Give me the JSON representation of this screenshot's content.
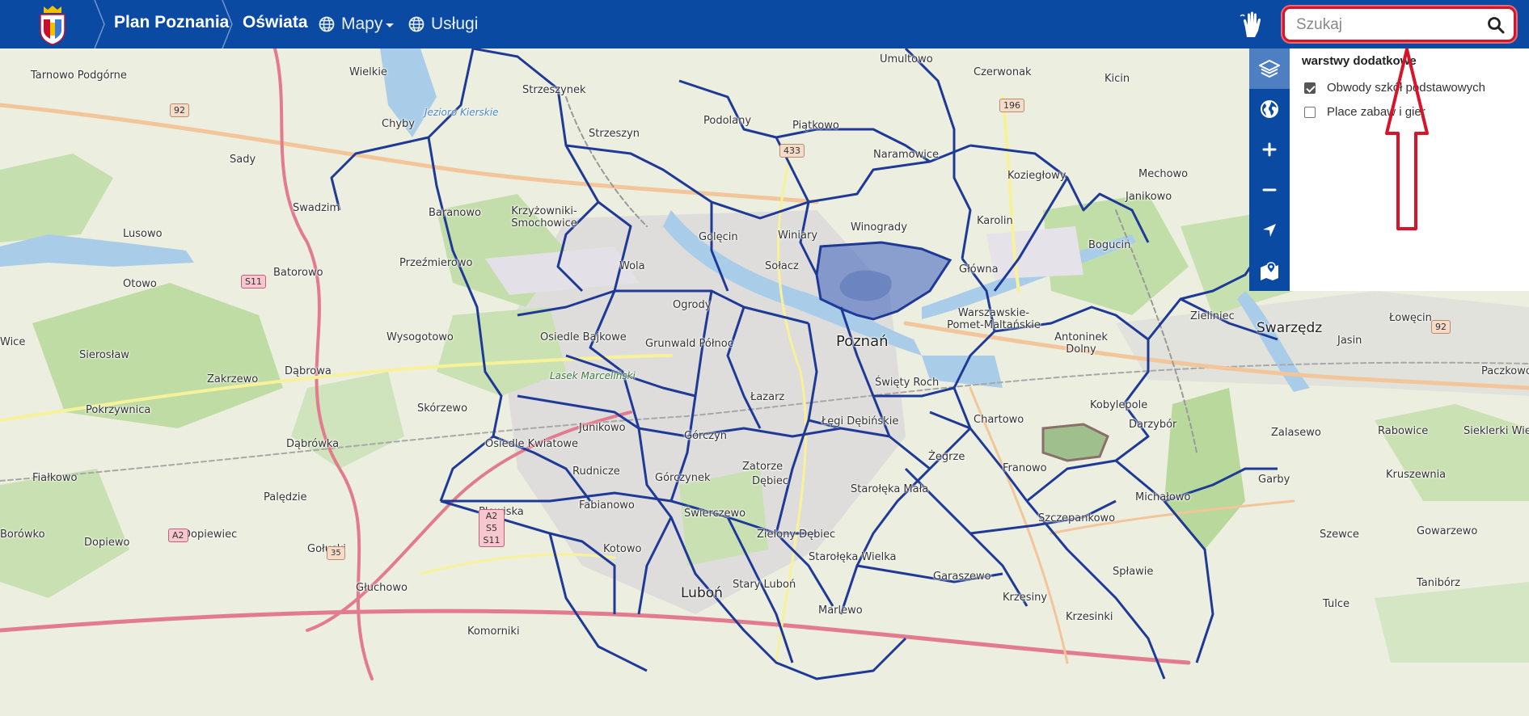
{
  "header": {
    "crumb_home": "Plan Poznania",
    "crumb_section": "Oświata",
    "nav_maps": "Mapy",
    "nav_services": "Usługi",
    "search_placeholder": "Szukaj"
  },
  "layers_panel": {
    "title": "warstwy dodatkowe",
    "layers": [
      {
        "label": "Obwody szkół podstawowych",
        "checked": true
      },
      {
        "label": "Place zabaw i gier",
        "checked": false
      }
    ]
  },
  "tools": [
    "layers-icon",
    "globe-icon",
    "zoom-in-icon",
    "zoom-out-icon",
    "locate-icon",
    "map-marker-icon"
  ],
  "colors": {
    "header_bg": "#0a4aa3",
    "boundary": "#1e3a96",
    "highlight": "#3c5fc0",
    "annotation": "#d6142a"
  },
  "map": {
    "places": [
      "Tarnowo Podgórne",
      "Wielkie",
      "Jezioro Kierskie",
      "Chyby",
      "Strzeszynek",
      "Umultowo",
      "Czerwonak",
      "Kicin",
      "Sady",
      "Strzeszyn",
      "Podolany",
      "Piątkowo",
      "Naramowice",
      "Koziegłowy",
      "Mechowo",
      "Swadzim",
      "Baranowo",
      "Krzyżowniki-Smochowice",
      "Golęcin",
      "Winiary",
      "Winogrady",
      "Karolin",
      "Janikowo",
      "Lusowo",
      "Bogucin",
      "Sołacz",
      "Główna",
      "Wola",
      "Batorowo",
      "Przeźmierowo",
      "Otowo",
      "Ogrody",
      "Zieliniec",
      "Warszawskie-Pomet-Maltańskie",
      "Swarzędz",
      "Łowęcin",
      "Wysogotowo",
      "Osiedle Bajkowe",
      "Grunwald Północ",
      "Poznań",
      "Antoninek Dolny",
      "Jasin",
      "Sierosław",
      "Zakrzewo",
      "Dąbrowa",
      "Lasek Marceliński",
      "Święty Roch",
      "Paczkowo",
      "Kobylepole",
      "Skórzewo",
      "Łazarz",
      "Pokrzywnica",
      "Junikowo",
      "Łęgi Dębińskie",
      "Chartowo",
      "Darzybór",
      "Zalasewo",
      "Rabowice",
      "Sieklerki Wielkie",
      "Dąbrówka",
      "Osiedle Kwiatowe",
      "Górczyn",
      "Żegrze",
      "Fiałkowo",
      "Rudnicze",
      "Zatorze",
      "Franowo",
      "Garby",
      "Kruszewnia",
      "Górczynek",
      "Dębiec",
      "Starołęka Mała",
      "Michałowo",
      "Palędzie",
      "Fabianowo",
      "Plewiska",
      "Świerczewo",
      "Szczepankowo",
      "Borówko",
      "Dopiewo",
      "Dopiewiec",
      "Gołuski",
      "Kotowo",
      "Zielony Dębiec",
      "Szewce",
      "Gowarzewo",
      "Starołęka Wielka",
      "Spławie",
      "Tulce",
      "Tanibórz",
      "Głuchowo",
      "Stary Luboń",
      "Garaszewo",
      "Luboń",
      "Krzesiny",
      "Marlewo",
      "Komorniki",
      "Krzesinki",
      "Wice"
    ],
    "roads": [
      "92",
      "196",
      "433",
      "S11",
      "A2",
      "A2 S5 S11",
      "35",
      "92"
    ]
  }
}
